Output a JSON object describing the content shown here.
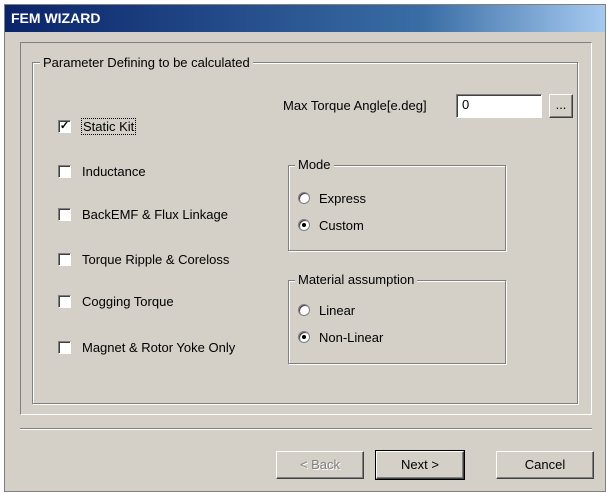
{
  "window": {
    "title": "FEM WIZARD"
  },
  "group": {
    "title": "Parameter Defining to be calculated"
  },
  "checkboxes": [
    {
      "label": "Static Kit",
      "checked": true
    },
    {
      "label": "Inductance",
      "checked": false
    },
    {
      "label": "BackEMF & Flux Linkage",
      "checked": false
    },
    {
      "label": "Torque Ripple & Coreloss",
      "checked": false
    },
    {
      "label": "Cogging Torque",
      "checked": false
    },
    {
      "label": "Magnet & Rotor Yoke Only",
      "checked": false
    }
  ],
  "max_torque": {
    "label": "Max Torque Angle[e.deg]",
    "value": "0",
    "browse_label": "..."
  },
  "mode": {
    "title": "Mode",
    "options": [
      {
        "label": "Express",
        "selected": false
      },
      {
        "label": "Custom",
        "selected": true
      }
    ]
  },
  "material": {
    "title": "Material assumption",
    "options": [
      {
        "label": "Linear",
        "selected": false
      },
      {
        "label": "Non-Linear",
        "selected": true
      }
    ]
  },
  "buttons": {
    "back_label": "< Back",
    "next_label": "Next >",
    "cancel_label": "Cancel"
  }
}
